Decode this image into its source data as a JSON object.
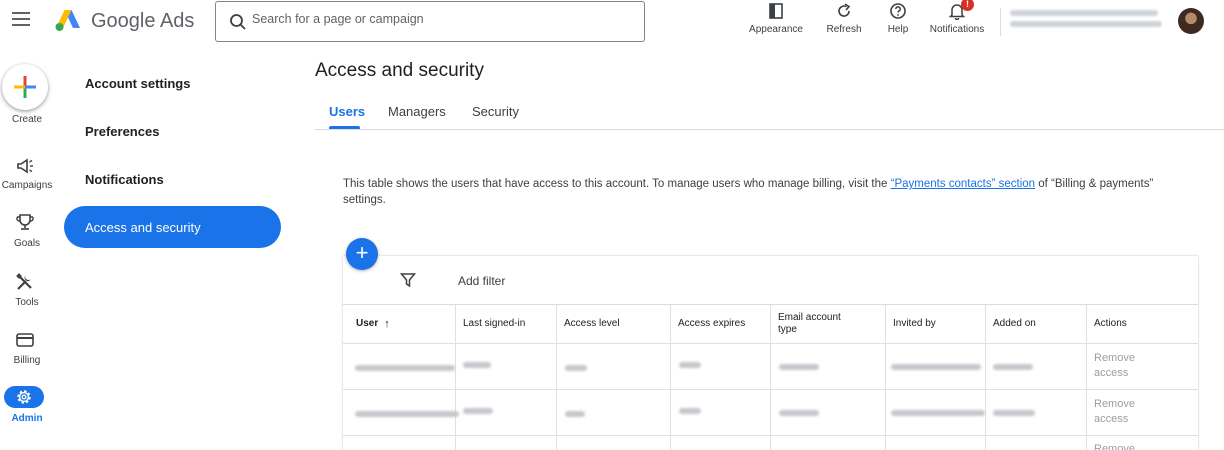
{
  "header": {
    "product_name": "Google Ads",
    "search": {
      "placeholder": "Search for a page or campaign",
      "value": ""
    },
    "tools": [
      {
        "label": "Appearance",
        "icon": "appearance-icon"
      },
      {
        "label": "Refresh",
        "icon": "refresh-icon"
      },
      {
        "label": "Help",
        "icon": "help-icon"
      },
      {
        "label": "Notifications",
        "icon": "notifications-icon"
      }
    ],
    "notification_badge": "!"
  },
  "rail": {
    "items": [
      {
        "label": "Create",
        "icon": "plus-icon"
      },
      {
        "label": "Campaigns",
        "icon": "megaphone-icon"
      },
      {
        "label": "Goals",
        "icon": "trophy-icon"
      },
      {
        "label": "Tools",
        "icon": "tools-icon"
      },
      {
        "label": "Billing",
        "icon": "credit-card-icon"
      },
      {
        "label": "Admin",
        "icon": "gear-icon"
      }
    ]
  },
  "settings_nav": {
    "items": [
      {
        "label": "Account settings",
        "active": false
      },
      {
        "label": "Preferences",
        "active": false
      },
      {
        "label": "Notifications",
        "active": false
      },
      {
        "label": "Access and security",
        "active": true
      }
    ]
  },
  "main": {
    "title": "Access and security",
    "tabs": [
      {
        "label": "Users",
        "active": true
      },
      {
        "label": "Managers",
        "active": false
      },
      {
        "label": "Security",
        "active": false
      }
    ],
    "description": {
      "before": "This table shows the users that have access to this account. To manage users who manage billing, visit the ",
      "link": "“Payments contacts” section",
      "after": " of “Billing & payments” settings."
    },
    "add_button": "+",
    "filter_label": "Add filter",
    "table": {
      "columns": [
        "User",
        "Last signed-in",
        "Access level",
        "Access expires",
        "Email account type",
        "Invited by",
        "Added on",
        "Actions"
      ],
      "sort_indicator": "↑",
      "row_action": "Remove access",
      "row_action_partial": "Remove"
    }
  },
  "colors": {
    "accent": "#1a73e8",
    "muted_link": "#9aa0a6"
  }
}
